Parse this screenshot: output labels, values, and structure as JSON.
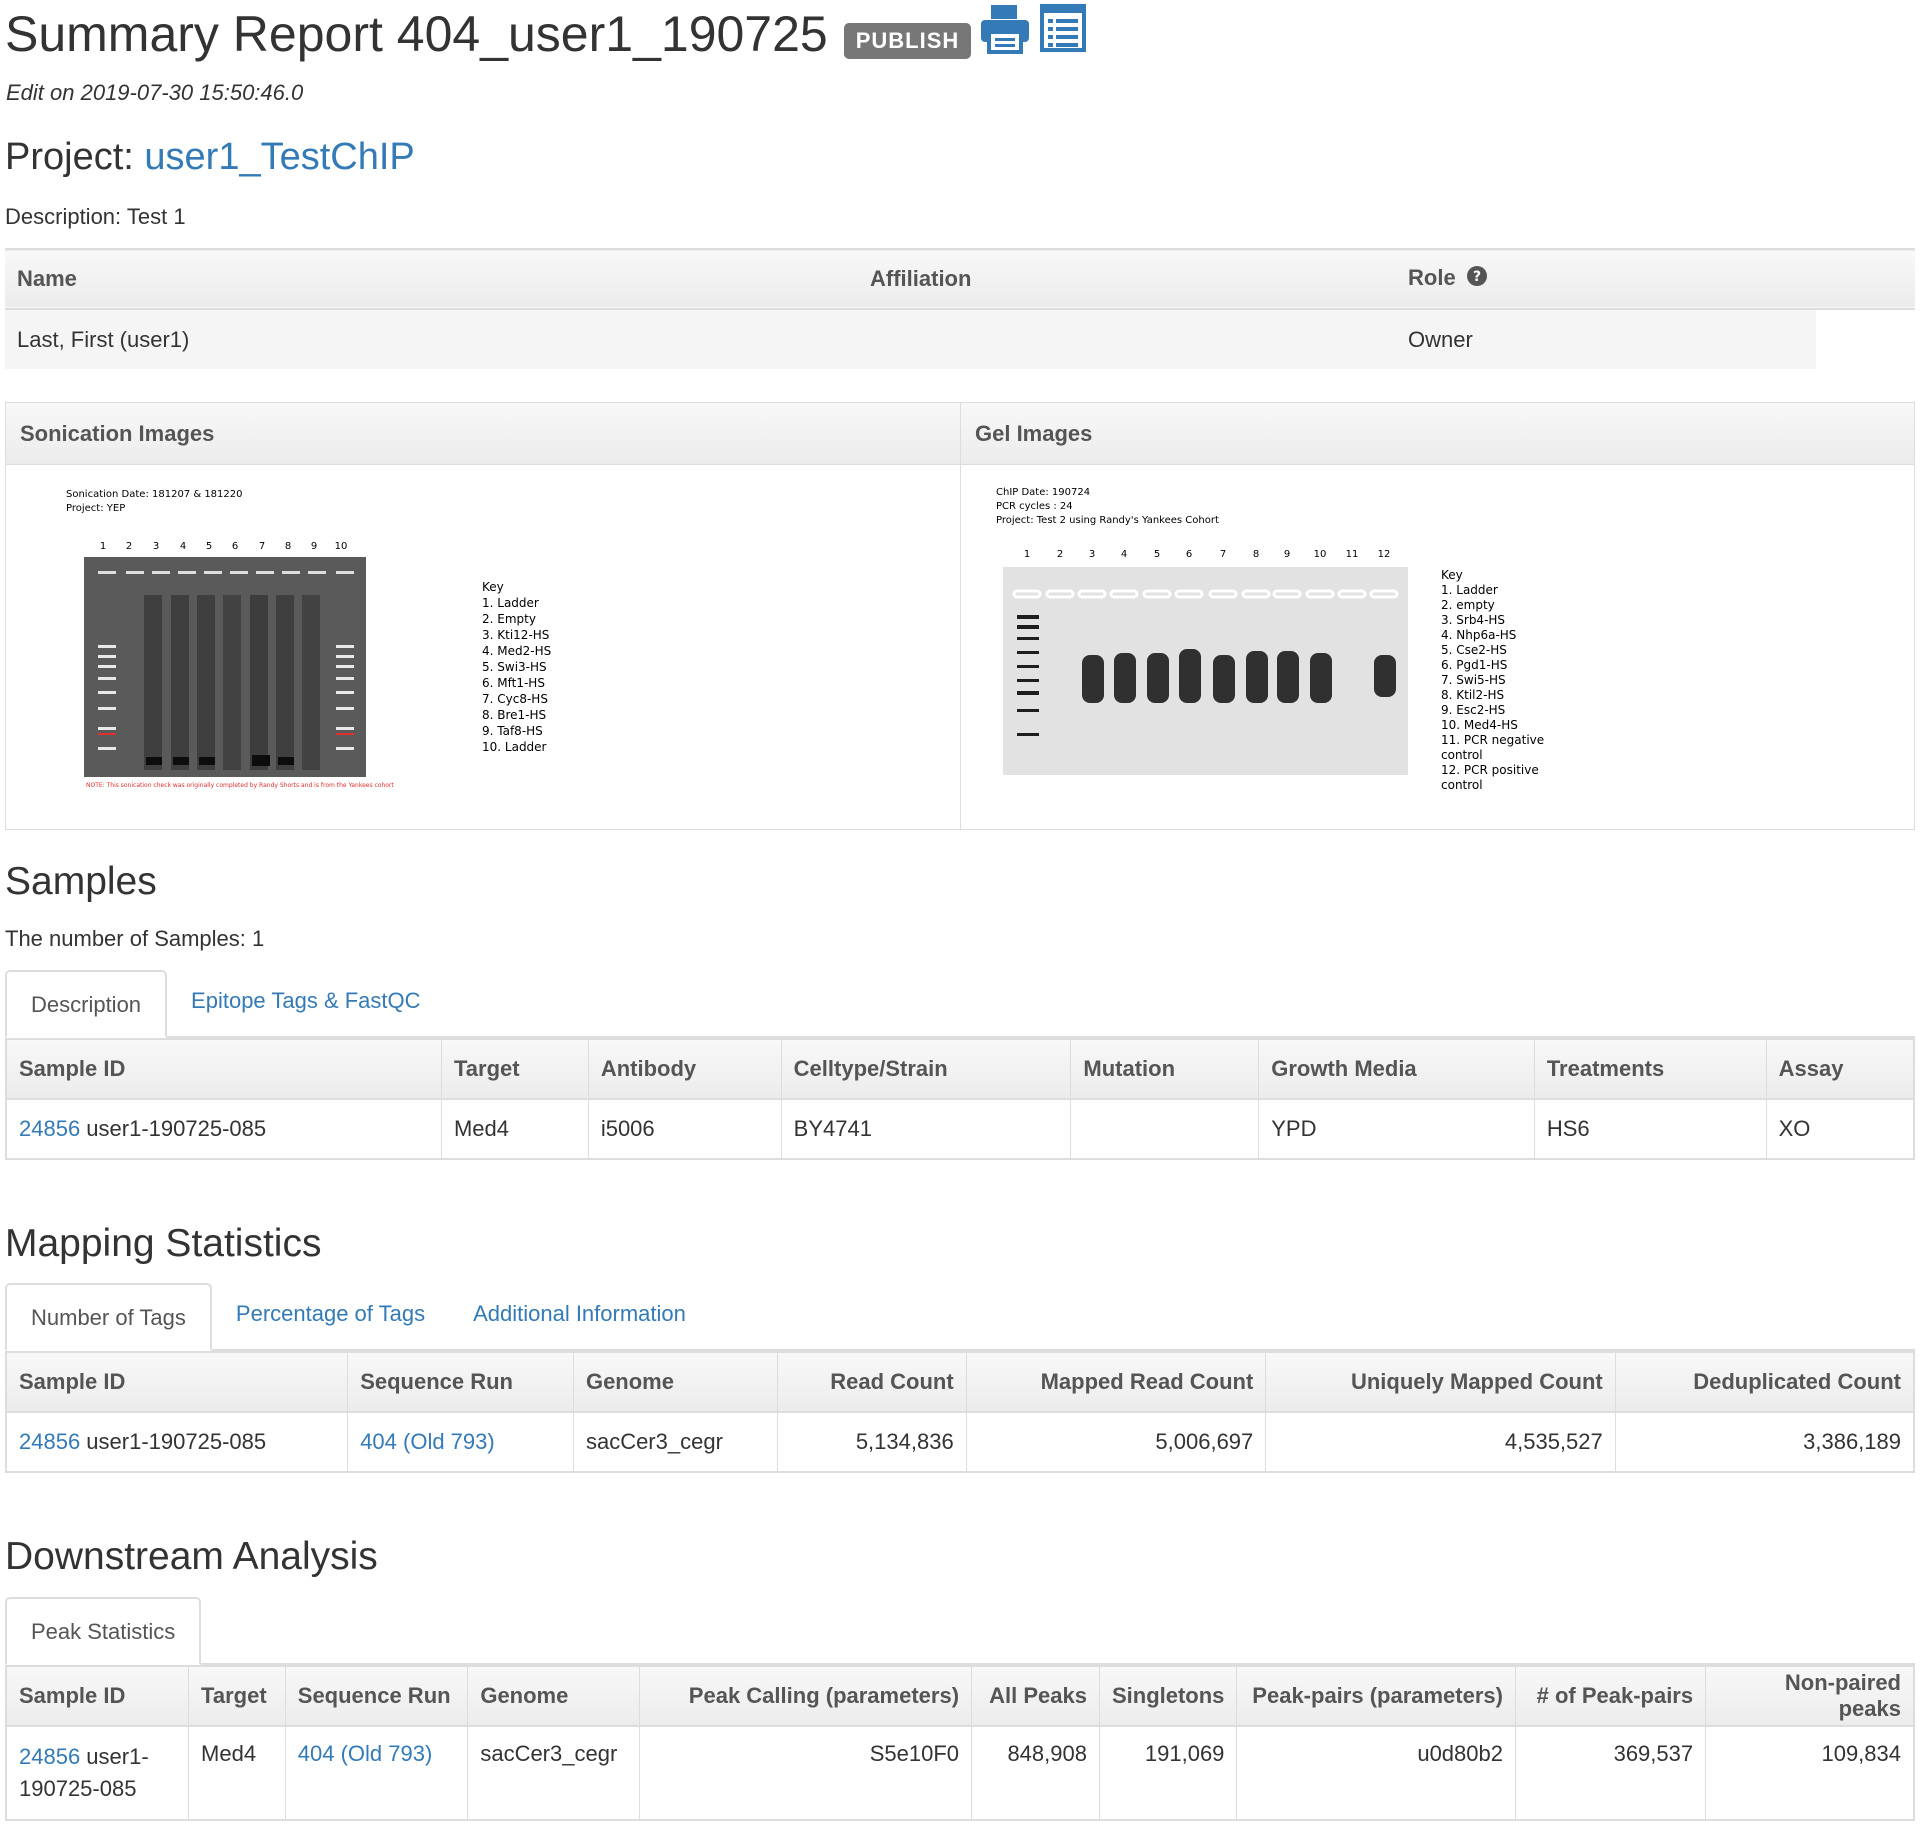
{
  "header": {
    "title": "Summary Report 404_user1_190725",
    "publish_label": "PUBLISH",
    "edit_line": "Edit on 2019-07-30 15:50:46.0",
    "print_icon": "printer-icon",
    "list_icon": "list-icon"
  },
  "project": {
    "label": "Project:",
    "name": "user1_TestChIP",
    "description": "Description: Test 1"
  },
  "members": {
    "headers": [
      "Name",
      "Affiliation",
      "Role"
    ],
    "role_help_icon": "question-circle-icon",
    "rows": [
      [
        "Last, First (user1)",
        "",
        "Owner"
      ]
    ]
  },
  "image_panels": {
    "sonication": {
      "heading": "Sonication Images",
      "info": [
        "Sonication Date: 181207 & 181220",
        "Project: YEP"
      ],
      "lanes": [
        "1",
        "2",
        "3",
        "4",
        "5",
        "6",
        "7",
        "8",
        "9",
        "10"
      ],
      "key_title": "Key",
      "key": [
        "1.  Ladder",
        "2.  Empty",
        "3.  Kti12-HS",
        "4.  Med2-HS",
        "5.  Swi3-HS",
        "6.  Mft1-HS",
        "7.  Cyc8-HS",
        "8.  Bre1-HS",
        "9.  Taf8-HS",
        "10. Ladder"
      ],
      "note": "NOTE: This sonication check was originally completed by Randy Shorts and is from the Yankees cohort"
    },
    "gel": {
      "heading": "Gel Images",
      "info": [
        "ChIP Date: 190724",
        "PCR cycles : 24",
        "Project: Test 2 using Randy's Yankees Cohort"
      ],
      "lanes": [
        "1",
        "2",
        "3",
        "4",
        "5",
        "6",
        "7",
        "8",
        "9",
        "10",
        "11",
        "12"
      ],
      "key_title": "Key",
      "key": [
        "1.  Ladder",
        "2.  empty",
        "3.  Srb4-HS",
        "4.  Nhp6a-HS",
        "5.  Cse2-HS",
        "6.  Pgd1-HS",
        "7.  Swi5-HS",
        "8.  Ktil2-HS",
        "9.  Esc2-HS",
        "10. Med4-HS",
        "11. PCR negative",
        "      control",
        "12. PCR positive",
        "      control"
      ]
    }
  },
  "samples": {
    "heading": "Samples",
    "count_text": "The number of Samples: 1",
    "tabs": [
      "Description",
      "Epitope Tags & FastQC"
    ],
    "headers": [
      "Sample ID",
      "Target",
      "Antibody",
      "Celltype/Strain",
      "Mutation",
      "Growth Media",
      "Treatments",
      "Assay"
    ],
    "rows": [
      {
        "id_link": "24856",
        "id_rest": " user1-190725-085",
        "target": "Med4",
        "antibody": "i5006",
        "strain": "BY4741",
        "mutation": "",
        "media": "YPD",
        "treatments": "HS6",
        "assay": "XO"
      }
    ]
  },
  "mapping": {
    "heading": "Mapping Statistics",
    "tabs": [
      "Number of Tags",
      "Percentage of Tags",
      "Additional Information"
    ],
    "headers": [
      "Sample ID",
      "Sequence Run",
      "Genome",
      "Read Count",
      "Mapped Read Count",
      "Uniquely Mapped Count",
      "Deduplicated Count"
    ],
    "rows": [
      {
        "id_link": "24856",
        "id_rest": " user1-190725-085",
        "run": "404 (Old 793)",
        "genome": "sacCer3_cegr",
        "read": "5,134,836",
        "mapped": "5,006,697",
        "unique": "4,535,527",
        "dedup": "3,386,189"
      }
    ]
  },
  "downstream": {
    "heading": "Downstream Analysis",
    "tabs": [
      "Peak Statistics"
    ],
    "headers": [
      "Sample ID",
      "Target",
      "Sequence Run",
      "Genome",
      "Peak Calling (parameters)",
      "All Peaks",
      "Singletons",
      "Peak-pairs (parameters)",
      "# of Peak-pairs",
      "Non-paired peaks"
    ],
    "rows": [
      {
        "id_link": "24856",
        "id_rest_1": " user1-",
        "id_rest_2": "190725-085",
        "target": "Med4",
        "run": "404 (Old 793)",
        "genome": "sacCer3_cegr",
        "peak_calling": "S5e10F0",
        "all_peaks": "848,908",
        "singletons": "191,069",
        "pairs_params": "u0d80b2",
        "num_pairs": "369,537",
        "nonpaired": "109,834"
      }
    ]
  }
}
